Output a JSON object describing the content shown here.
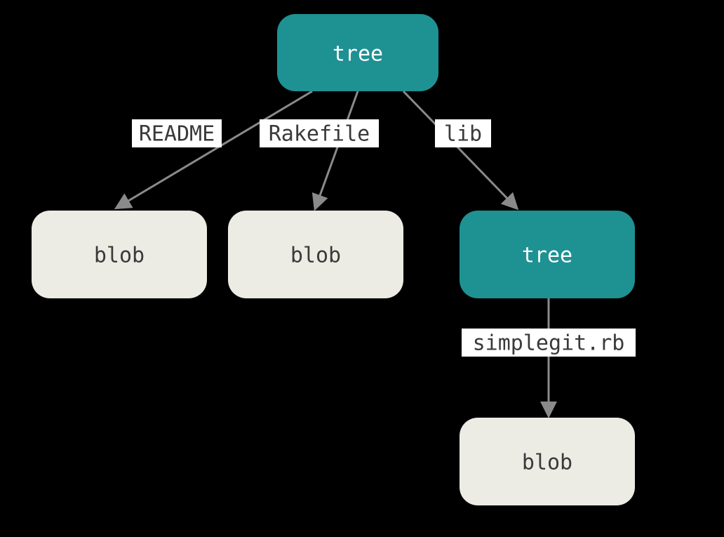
{
  "diagram": {
    "nodes": {
      "root": {
        "label": "tree",
        "type": "tree"
      },
      "readme": {
        "label": "blob",
        "type": "blob"
      },
      "rakefile": {
        "label": "blob",
        "type": "blob"
      },
      "lib": {
        "label": "tree",
        "type": "tree"
      },
      "simplegit": {
        "label": "blob",
        "type": "blob"
      }
    },
    "edges": {
      "root_readme": {
        "label": "README"
      },
      "root_rakefile": {
        "label": "Rakefile"
      },
      "root_lib": {
        "label": "lib"
      },
      "lib_simplegit": {
        "label": "simplegit.rb"
      }
    }
  }
}
